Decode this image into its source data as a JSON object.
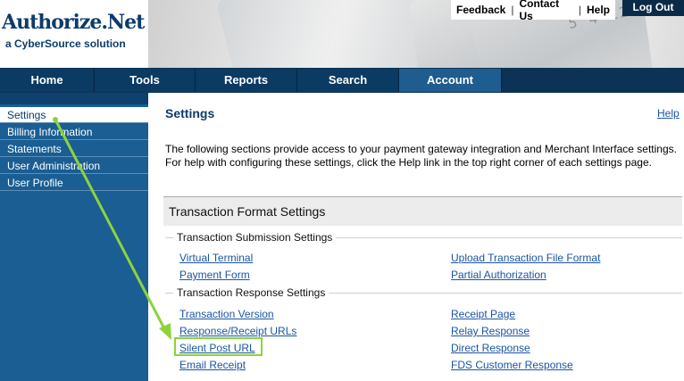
{
  "header": {
    "logo_main": "Authorize.Net",
    "logo_sub": "a CyberSource solution",
    "card_digits": "5 4 12",
    "top_links": [
      "Feedback",
      "Contact Us",
      "Help"
    ],
    "logout": "Log Out"
  },
  "nav": {
    "tabs": [
      {
        "label": "Home"
      },
      {
        "label": "Tools"
      },
      {
        "label": "Reports"
      },
      {
        "label": "Search"
      },
      {
        "label": "Account"
      }
    ],
    "active": "Account"
  },
  "sidebar": {
    "items": [
      {
        "label": "Settings"
      },
      {
        "label": "Billing Information"
      },
      {
        "label": "Statements"
      },
      {
        "label": "User Administration"
      },
      {
        "label": "User Profile"
      }
    ],
    "active": "Settings"
  },
  "main": {
    "title": "Settings",
    "help": "Help",
    "intro": "The following sections provide access to your payment gateway integration and Merchant Interface settings. For help with configuring these settings, click the Help link in the top right corner of each settings page.",
    "section_title": "Transaction Format Settings",
    "groups": [
      {
        "label": "Transaction Submission Settings",
        "links_left": [
          "Virtual Terminal",
          "Payment Form"
        ],
        "links_right": [
          "Upload Transaction File Format",
          "Partial Authorization"
        ]
      },
      {
        "label": "Transaction Response Settings",
        "links_left": [
          "Transaction Version",
          "Response/Receipt URLs",
          "Silent Post URL",
          "Email Receipt"
        ],
        "links_right": [
          "Receipt Page",
          "Relay Response",
          "Direct Response",
          "FDS Customer Response"
        ]
      }
    ]
  },
  "colors": {
    "brand": "#0c3b6b",
    "nav_active": "#1f5c8f",
    "sidebar": "#1a5e93",
    "link": "#1a55a3",
    "annotation": "#8cd43b"
  }
}
